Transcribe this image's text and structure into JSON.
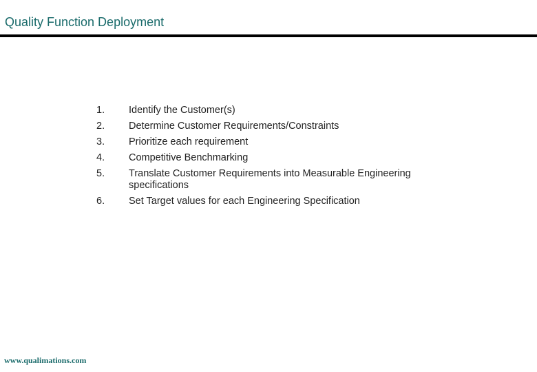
{
  "slide": {
    "title": "Quality Function Deployment",
    "steps": [
      {
        "number": "1.",
        "text": "Identify the Customer(s)"
      },
      {
        "number": "2.",
        "text": "Determine Customer Requirements/Constraints"
      },
      {
        "number": "3.",
        "text": "Prioritize each requirement"
      },
      {
        "number": "4.",
        "text": "Competitive Benchmarking"
      },
      {
        "number": "5.",
        "text": "Translate Customer Requirements into Measurable Engineering specifications"
      },
      {
        "number": "6.",
        "text": "Set Target values for each Engineering Specification"
      }
    ],
    "footer": "www.qualimations.com",
    "colors": {
      "title": "#1a6b6b",
      "rule": "#000000",
      "body_text": "#222222"
    }
  }
}
